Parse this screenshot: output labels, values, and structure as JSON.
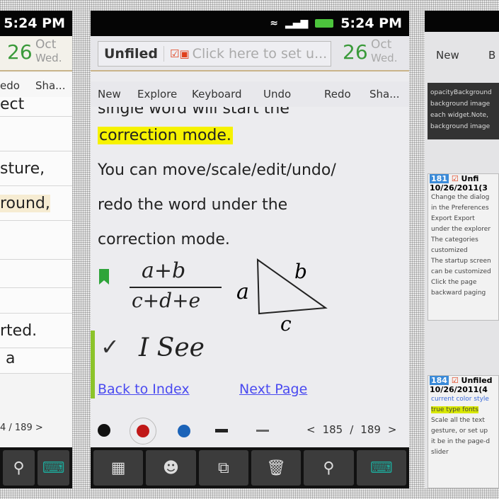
{
  "status": {
    "time": "5:24 PM"
  },
  "date": {
    "day": "26",
    "month": "Oct",
    "weekday": "Wed."
  },
  "header": {
    "folder": "Unfiled",
    "title_placeholder": "Click here to set u..."
  },
  "toolbar": [
    "New",
    "Explore",
    "Keyboard",
    "Undo",
    "Redo",
    "Sha..."
  ],
  "main": {
    "lines": [
      "single word will start the",
      "correction mode.",
      "You can move/scale/edit/undo/",
      "redo the word under the",
      "correction mode."
    ],
    "handwriting": {
      "numerator": "a+b",
      "denominator": "c+d+e",
      "tri_a": "a",
      "tri_b": "b",
      "tri_c": "c",
      "check_text": "I See"
    },
    "links": {
      "back": "Back to Index",
      "next": "Next Page"
    },
    "pen_colors": [
      "#111111",
      "#c01818",
      "#1b63b8"
    ],
    "pager": {
      "prev": "<",
      "current": "185",
      "sep": "/",
      "total": "189",
      "next": ">"
    }
  },
  "bottom_buttons": [
    "layout",
    "emoticon",
    "paste",
    "delete",
    "search",
    "keyboard"
  ],
  "left_panel": {
    "toolbar": [
      "edo",
      "Sha..."
    ],
    "lines": [
      "ect",
      "",
      "sture,",
      "round,",
      "",
      "",
      "",
      "rted.",
      "a"
    ],
    "pager": "4 / 189 >"
  },
  "right_panel": {
    "toolbar": [
      "New",
      "B"
    ],
    "dark_note": [
      "opacityBackground",
      "background image",
      "each widget.Note,",
      "background image"
    ],
    "note1": {
      "num": "181",
      "title": "Unfi",
      "date": "10/26/2011(3",
      "lines": [
        "Change the dialog",
        "in the Preferences",
        "Export Export",
        "under the explorer",
        "The categories",
        "customized",
        "The startup screen",
        "can be customized",
        "Click the page",
        "backward paging"
      ]
    },
    "note2": {
      "num": "184",
      "title": "Unfiled",
      "date": "10/26/2011(4",
      "lines": [
        "current color style",
        "true type fonts",
        "Scale all the text",
        "gesture, or set up",
        "it be in the page-d",
        "slider"
      ]
    }
  }
}
